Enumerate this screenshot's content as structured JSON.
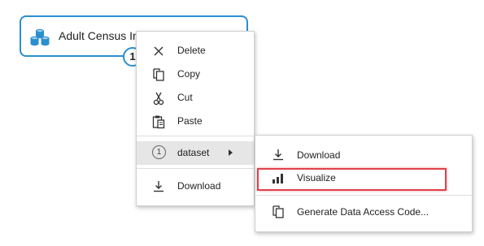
{
  "node": {
    "title": "Adult Census In",
    "port_label": "1",
    "icon": "database-stack-icon",
    "border_color": "#2b8fce"
  },
  "context_menu": {
    "items": [
      {
        "label": "Delete",
        "icon": "delete-x-icon"
      },
      {
        "label": "Copy",
        "icon": "copy-icon"
      },
      {
        "label": "Cut",
        "icon": "scissors-icon"
      },
      {
        "label": "Paste",
        "icon": "paste-icon"
      },
      {
        "label": "dataset",
        "icon": "circled-number-icon",
        "badge": "1",
        "has_submenu": true
      },
      {
        "label": "Download",
        "icon": "download-icon"
      }
    ]
  },
  "submenu": {
    "items": [
      {
        "label": "Download",
        "icon": "download-icon"
      },
      {
        "label": "Visualize",
        "icon": "bar-chart-icon",
        "highlighted": true
      },
      {
        "label": "Generate Data Access Code...",
        "icon": "copy-code-icon"
      }
    ]
  },
  "colors": {
    "highlight_outline": "#e0414b",
    "hover_bg": "#e6e6e6"
  }
}
